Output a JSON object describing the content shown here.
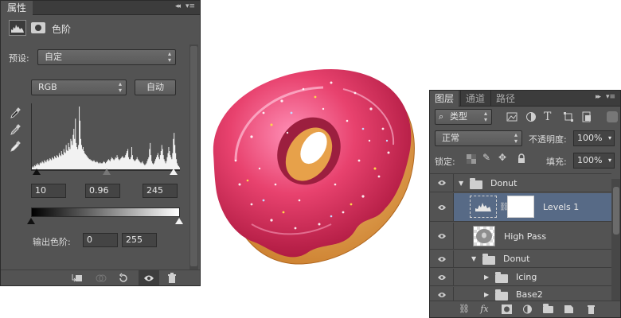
{
  "properties": {
    "tab_label": "属性",
    "collapse_glyph": "◂◂",
    "menu_glyph": "▾≡",
    "title": "色阶",
    "preset_label": "预设:",
    "preset_value": "自定",
    "channel_value": "RGB",
    "auto_button": "自动",
    "input_levels": {
      "black": "10",
      "gamma": "0.96",
      "white": "245"
    },
    "output_label": "输出色阶:",
    "output_levels": {
      "black": "0",
      "white": "255"
    },
    "histogram": [
      2,
      3,
      2,
      4,
      3,
      5,
      4,
      6,
      5,
      4,
      6,
      7,
      6,
      8,
      7,
      6,
      9,
      8,
      7,
      9,
      10,
      8,
      9,
      11,
      10,
      9,
      12,
      11,
      10,
      13,
      12,
      11,
      14,
      13,
      12,
      16,
      14,
      13,
      18,
      15,
      14,
      20,
      17,
      16,
      24,
      19,
      18,
      26,
      22,
      20,
      30,
      28,
      24,
      34,
      40,
      30,
      50,
      26,
      22,
      20,
      24,
      62,
      48,
      30,
      24,
      20,
      22,
      18,
      16,
      15,
      14,
      13,
      12,
      11,
      10,
      10,
      9,
      9,
      8,
      8,
      9,
      8,
      7,
      7,
      8,
      7,
      6,
      6,
      7,
      6,
      6,
      6,
      7,
      8,
      7,
      6,
      7,
      8,
      9,
      10,
      9,
      8,
      10,
      12,
      11,
      10,
      9,
      10,
      12,
      11,
      14,
      12,
      10,
      9,
      10,
      11,
      12,
      13,
      12,
      11,
      12,
      14,
      16,
      18,
      20,
      12,
      10,
      10,
      12,
      22,
      14,
      10,
      9,
      8,
      9,
      10,
      12,
      10,
      9,
      8,
      7,
      6,
      7,
      8,
      6,
      5,
      4,
      5,
      6,
      8,
      10,
      12,
      20,
      26,
      14,
      8,
      6,
      5,
      6,
      8,
      10,
      12,
      14,
      16,
      12,
      10,
      14,
      18,
      24,
      20,
      14,
      10,
      8,
      6,
      8,
      12,
      16,
      22,
      18,
      14,
      12,
      10,
      16,
      30,
      36,
      24,
      16,
      10,
      6,
      4,
      3,
      2
    ]
  },
  "layers": {
    "tabs": [
      "图层",
      "通道",
      "路径"
    ],
    "active_tab": "图层",
    "filter_kind": "类型",
    "blend_mode": "正常",
    "opacity_label": "不透明度:",
    "opacity_value": "100%",
    "lock_label": "锁定:",
    "fill_label": "填充:",
    "fill_value": "100%",
    "items": [
      {
        "name": "Donut",
        "type": "group",
        "expanded": true
      },
      {
        "name": "Levels 1",
        "type": "adjustment",
        "selected": true
      },
      {
        "name": "High Pass",
        "type": "smart-object"
      },
      {
        "name": "Donut",
        "type": "group",
        "expanded": true
      },
      {
        "name": "Icing",
        "type": "group",
        "expanded": false
      },
      {
        "name": "Base2",
        "type": "group",
        "expanded": false
      }
    ],
    "footer_icons": [
      "link-icon",
      "fx-icon",
      "add-mask-icon",
      "new-adjustment-icon",
      "new-group-icon",
      "new-layer-icon",
      "delete-icon"
    ]
  },
  "colors": {
    "panel_bg": "#535353",
    "selected_row": "#576a86",
    "donut_icing": "#e0406a",
    "donut_dough": "#e7a64d"
  }
}
